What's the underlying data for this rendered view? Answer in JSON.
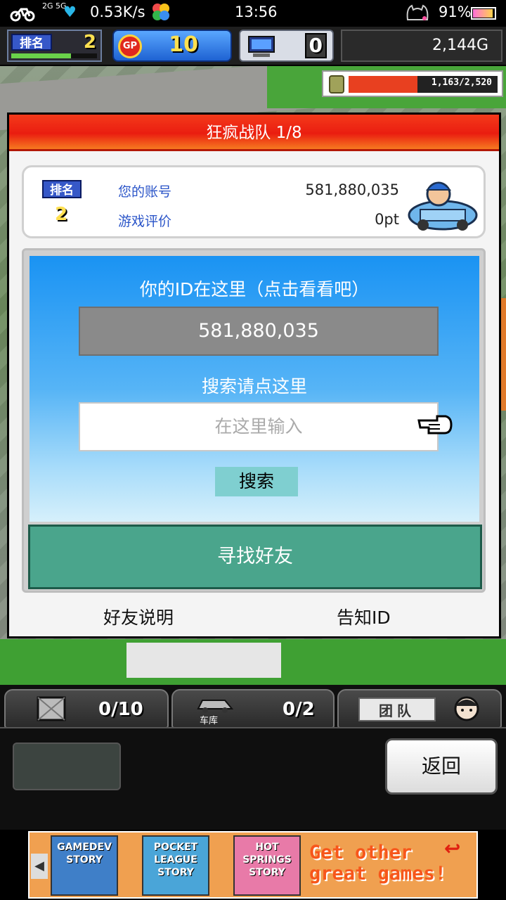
{
  "status_bar": {
    "network_speed": "0.53K/s",
    "network_badge": "2G 5G",
    "time": "13:56",
    "battery_percent": "91%"
  },
  "hud": {
    "rank_label": "排名",
    "rank_value": "2",
    "rank_progress": 0.7,
    "gp_icon_label": "GP",
    "gp_value": "10",
    "pc_value": "0",
    "gold": "2,144G",
    "energy_text": "1,163/2,520",
    "energy_fraction": 0.46
  },
  "dialog": {
    "title": "狂疯战队 1/8",
    "info": {
      "rank_label": "排名",
      "rank_value": "2",
      "account_label": "您的账号",
      "account_value": "581,880,035",
      "rating_label": "游戏评价",
      "rating_value": "0pt"
    },
    "search": {
      "id_caption": "你的ID在这里（点击看看吧）",
      "id_value": "581,880,035",
      "search_caption": "搜索请点这里",
      "input_placeholder": "在这里输入",
      "search_button": "搜索",
      "find_friend_button": "寻找好友"
    },
    "links": {
      "friend_help": "好友说明",
      "notify_id": "告知ID"
    }
  },
  "bottom_hud": {
    "stock_value": "0/10",
    "garage_label": "车库",
    "garage_value": "0/2",
    "team_label": "团队",
    "back_button": "返回"
  },
  "ad_banner": {
    "games": [
      "GAMEDEV STORY",
      "POCKET LEAGUE STORY",
      "HOT SPRINGS STORY"
    ],
    "cta": "Get other great games!"
  },
  "colors": {
    "title_red": "#ea1d10",
    "search_blue": "#1a93f3",
    "find_friend_green": "#4aa58c",
    "account_label_blue": "#2a54c8"
  }
}
